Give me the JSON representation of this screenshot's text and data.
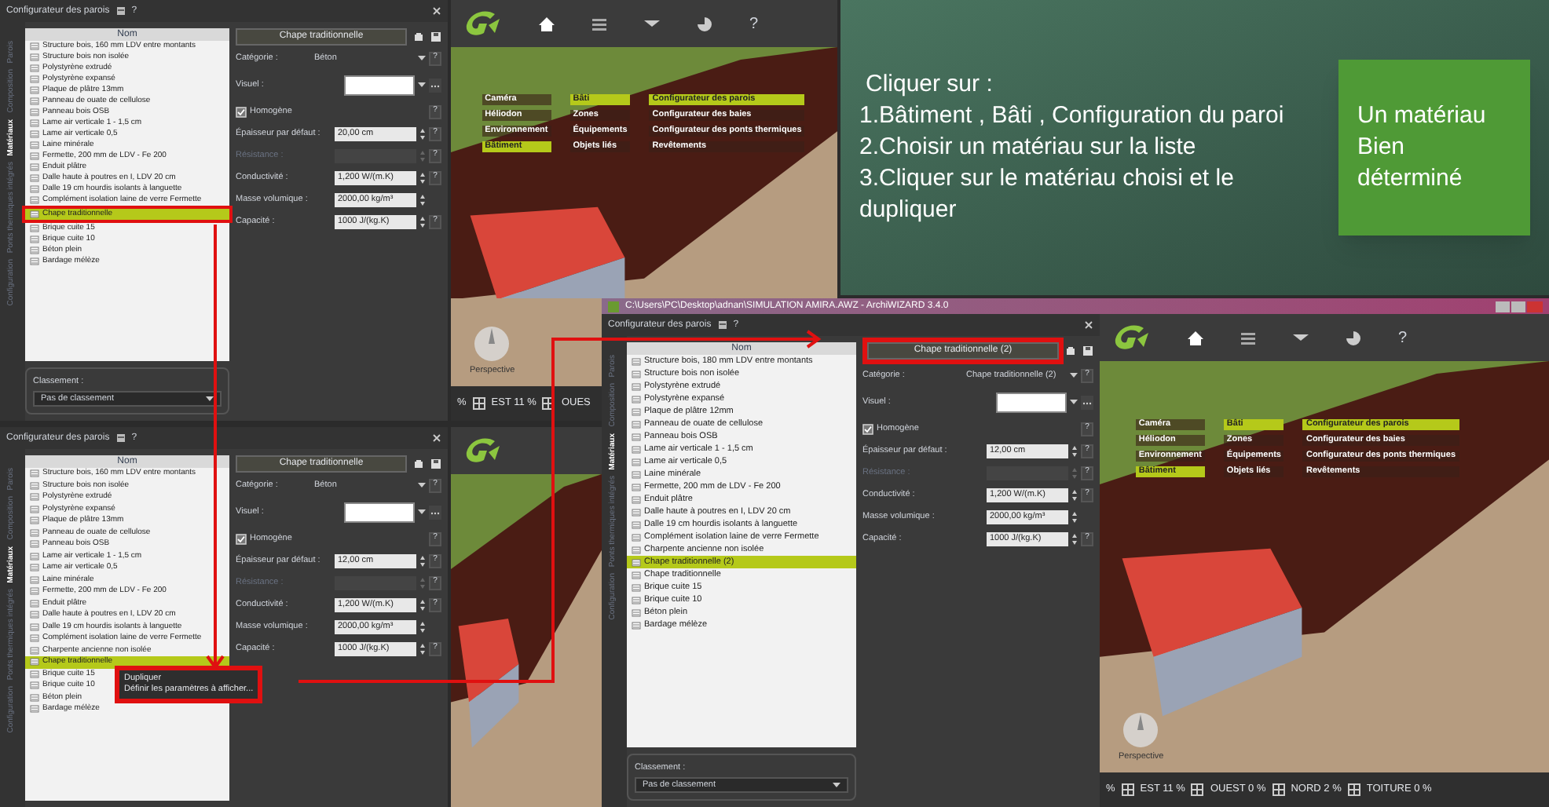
{
  "dialogs": [
    {
      "title": "Configurateur des parois",
      "help": "?",
      "row_framed": true,
      "tabs": [
        {
          "label": "Configuration",
          "selected": false
        },
        {
          "label": "Ponts thermiques intégrés",
          "selected": false
        },
        {
          "label": "Matériaux",
          "selected": true
        },
        {
          "label": "Composition",
          "selected": false
        },
        {
          "label": "Parois",
          "selected": false
        }
      ],
      "column": "Nom",
      "items": [
        {
          "label": "Structure bois, 160 mm LDV entre montants",
          "selected": false
        },
        {
          "label": "Structure bois non isolée",
          "selected": false
        },
        {
          "label": "Polystyrène extrudé",
          "selected": false
        },
        {
          "label": "Polystyrène expansé",
          "selected": false
        },
        {
          "label": "Plaque de plâtre 13mm",
          "selected": false
        },
        {
          "label": "Panneau de ouate de cellulose",
          "selected": false
        },
        {
          "label": "Panneau bois OSB",
          "selected": false
        },
        {
          "label": "Lame air verticale 1 - 1,5 cm",
          "selected": false
        },
        {
          "label": "Lame air verticale 0,5",
          "selected": false
        },
        {
          "label": "Laine minérale",
          "selected": false
        },
        {
          "label": "Fermette, 200 mm de LDV - Fe 200",
          "selected": false
        },
        {
          "label": "Enduit plâtre",
          "selected": false
        },
        {
          "label": "Dalle haute à poutres en I, LDV 20 cm",
          "selected": false
        },
        {
          "label": "Dalle 19 cm hourdis isolants à languette",
          "selected": false
        },
        {
          "label": "Complément isolation laine de verre Fermette",
          "selected": false
        },
        {
          "label": "Chape traditionnelle",
          "selected": true
        },
        {
          "label": "Brique cuite 15",
          "selected": false
        },
        {
          "label": "Brique cuite 10",
          "selected": false
        },
        {
          "label": "Béton plein",
          "selected": false
        },
        {
          "label": "Bardage mélèze",
          "selected": false
        }
      ],
      "header": "Chape traditionnelle",
      "fields": [
        {
          "kind": "select",
          "label": "Catégorie :",
          "value": "Béton",
          "help": "?"
        },
        {
          "kind": "color",
          "label": "Visuel :"
        },
        {
          "kind": "check",
          "label": "Homogène",
          "checked": true,
          "help": "?"
        },
        {
          "kind": "number",
          "label": "Épaisseur par défaut :",
          "value": "20,00 cm",
          "disabled": false,
          "help": "?"
        },
        {
          "kind": "number",
          "label": "Résistance :",
          "disabled": true,
          "help": "?"
        },
        {
          "kind": "number",
          "label": "Conductivité :",
          "value": "1,200 W/(m.K)",
          "disabled": false,
          "help": "?"
        },
        {
          "kind": "number",
          "label": "Masse volumique :",
          "value": "2000,00 kg/m³",
          "disabled": false
        },
        {
          "kind": "number",
          "label": "Capacité :",
          "value": "1000 J/(kg.K)",
          "disabled": false,
          "help": "?"
        }
      ],
      "classement_label": "Classement :",
      "classement_value": "Pas de classement"
    },
    {
      "title": "Configurateur des parois",
      "help": "?",
      "menu_framed": true,
      "tabs": [
        {
          "label": "Configuration",
          "selected": false
        },
        {
          "label": "Ponts thermiques intégrés",
          "selected": false
        },
        {
          "label": "Matériaux",
          "selected": true
        },
        {
          "label": "Composition",
          "selected": false
        },
        {
          "label": "Parois",
          "selected": false
        }
      ],
      "column": "Nom",
      "items": [
        {
          "label": "Structure bois, 160 mm LDV entre montants",
          "selected": false
        },
        {
          "label": "Structure bois non isolée",
          "selected": false
        },
        {
          "label": "Polystyrène extrudé",
          "selected": false
        },
        {
          "label": "Polystyrène expansé",
          "selected": false
        },
        {
          "label": "Plaque de plâtre 13mm",
          "selected": false
        },
        {
          "label": "Panneau de ouate de cellulose",
          "selected": false
        },
        {
          "label": "Panneau bois OSB",
          "selected": false
        },
        {
          "label": "Lame air verticale 1 - 1,5 cm",
          "selected": false
        },
        {
          "label": "Lame air verticale 0,5",
          "selected": false
        },
        {
          "label": "Laine minérale",
          "selected": false
        },
        {
          "label": "Fermette, 200 mm de LDV - Fe 200",
          "selected": false
        },
        {
          "label": "Enduit plâtre",
          "selected": false
        },
        {
          "label": "Dalle haute à poutres en I, LDV 20 cm",
          "selected": false
        },
        {
          "label": "Dalle 19 cm hourdis isolants à languette",
          "selected": false
        },
        {
          "label": "Complément isolation laine de verre Fermette",
          "selected": false
        },
        {
          "label": "Charpente ancienne non isolée",
          "selected": false
        },
        {
          "label": "Chape traditionnelle",
          "selected": true
        },
        {
          "label": "Brique cuite 15",
          "selected": false
        },
        {
          "label": "Brique cuite 10",
          "selected": false
        },
        {
          "label": "Béton plein",
          "selected": false
        },
        {
          "label": "Bardage mélèze",
          "selected": false
        }
      ],
      "header": "Chape traditionnelle",
      "fields": [
        {
          "kind": "select",
          "label": "Catégorie :",
          "value": "Béton",
          "help": "?"
        },
        {
          "kind": "color",
          "label": "Visuel :"
        },
        {
          "kind": "check",
          "label": "Homogène",
          "checked": true,
          "help": "?"
        },
        {
          "kind": "number",
          "label": "Épaisseur par défaut :",
          "value": "12,00 cm",
          "disabled": false,
          "help": "?"
        },
        {
          "kind": "number",
          "label": "Résistance :",
          "disabled": true,
          "help": "?"
        },
        {
          "kind": "number",
          "label": "Conductivité :",
          "value": "1,200 W/(m.K)",
          "disabled": false,
          "help": "?"
        },
        {
          "kind": "number",
          "label": "Masse volumique :",
          "value": "2000,00 kg/m³",
          "disabled": false
        },
        {
          "kind": "number",
          "label": "Capacité :",
          "value": "1000 J/(kg.K)",
          "disabled": false,
          "help": "?"
        }
      ],
      "context_menu": [
        "Dupliquer",
        "Définir les paramètres à afficher..."
      ]
    },
    {
      "title": "Configurateur des parois",
      "help": "?",
      "header_framed": true,
      "tabs": [
        {
          "label": "Configuration",
          "selected": false
        },
        {
          "label": "Ponts thermiques intégrés",
          "selected": false
        },
        {
          "label": "Matériaux",
          "selected": true
        },
        {
          "label": "Composition",
          "selected": false
        },
        {
          "label": "Parois",
          "selected": false
        }
      ],
      "column": "Nom",
      "items": [
        {
          "label": "Structure bois, 180 mm LDV entre montants",
          "selected": false
        },
        {
          "label": "Structure bois non isolée",
          "selected": false
        },
        {
          "label": "Polystyrène extrudé",
          "selected": false
        },
        {
          "label": "Polystyrène expansé",
          "selected": false
        },
        {
          "label": "Plaque de plâtre 12mm",
          "selected": false
        },
        {
          "label": "Panneau de ouate de cellulose",
          "selected": false
        },
        {
          "label": "Panneau bois OSB",
          "selected": false
        },
        {
          "label": "Lame air verticale 1 - 1,5 cm",
          "selected": false
        },
        {
          "label": "Lame air verticale 0,5",
          "selected": false
        },
        {
          "label": "Laine minérale",
          "selected": false
        },
        {
          "label": "Fermette, 200 mm de LDV - Fe 200",
          "selected": false
        },
        {
          "label": "Enduit plâtre",
          "selected": false
        },
        {
          "label": "Dalle haute à poutres en I, LDV 20 cm",
          "selected": false
        },
        {
          "label": "Dalle 19 cm hourdis isolants à languette",
          "selected": false
        },
        {
          "label": "Complément isolation laine de verre Fermette",
          "selected": false
        },
        {
          "label": "Charpente ancienne non isolée",
          "selected": false
        },
        {
          "label": "Chape traditionnelle (2)",
          "selected": true
        },
        {
          "label": "Chape traditionnelle",
          "selected": false
        },
        {
          "label": "Brique cuite 15",
          "selected": false
        },
        {
          "label": "Brique cuite 10",
          "selected": false
        },
        {
          "label": "Béton plein",
          "selected": false
        },
        {
          "label": "Bardage mélèze",
          "selected": false
        }
      ],
      "header": "Chape traditionnelle (2)",
      "fields": [
        {
          "kind": "select",
          "label": "Catégorie :",
          "value": "Chape traditionnelle (2)",
          "help": "?"
        },
        {
          "kind": "color",
          "label": "Visuel :"
        },
        {
          "kind": "check",
          "label": "Homogène",
          "checked": true,
          "help": "?"
        },
        {
          "kind": "number",
          "label": "Épaisseur par défaut :",
          "value": "12,00 cm",
          "disabled": false,
          "help": "?"
        },
        {
          "kind": "number",
          "label": "Résistance :",
          "disabled": true,
          "help": "?"
        },
        {
          "kind": "number",
          "label": "Conductivité :",
          "value": "1,200 W/(m.K)",
          "disabled": false,
          "help": "?"
        },
        {
          "kind": "number",
          "label": "Masse volumique :",
          "value": "2000,00 kg/m³",
          "disabled": false
        },
        {
          "kind": "number",
          "label": "Capacité :",
          "value": "1000 J/(kg.K)",
          "disabled": false,
          "help": "?"
        }
      ],
      "classement_label": "Classement :",
      "classement_value": "Pas de classement"
    }
  ],
  "views": [
    {
      "help": "?",
      "menu": [
        [
          {
            "label": "Caméra",
            "selected": false
          },
          {
            "label": "Héliodon",
            "selected": false
          },
          {
            "label": "Environnement",
            "selected": false
          },
          {
            "label": "Bâtiment",
            "selected": true
          }
        ],
        [
          {
            "label": "Bâti",
            "selected": true
          },
          {
            "label": "Zones",
            "selected": false
          },
          {
            "label": "Équipements",
            "selected": false
          },
          {
            "label": "Objets liés",
            "selected": false
          }
        ],
        [
          {
            "label": "Configurateur des parois",
            "selected": true
          },
          {
            "label": "Configurateur des baies",
            "selected": false
          },
          {
            "label": "Configurateur des ponts thermiques",
            "selected": false
          },
          {
            "label": "Revêtements",
            "selected": false
          }
        ]
      ],
      "compass_label": "Perspective",
      "status": [
        "%",
        "EST 11 %",
        "OUES"
      ]
    },
    {
      "help": "?",
      "menu": [
        [
          {
            "label": "Caméra",
            "selected": false
          },
          {
            "label": "Héliodon",
            "selected": false
          },
          {
            "label": "Environnement",
            "selected": false
          },
          {
            "label": "Bâtiment",
            "selected": true
          }
        ],
        [
          {
            "label": "Bâti",
            "selected": true
          },
          {
            "label": "Zones",
            "selected": false
          },
          {
            "label": "Équipements",
            "selected": false
          },
          {
            "label": "Objets liés",
            "selected": false
          }
        ],
        [
          {
            "label": "Configurateur des parois",
            "selected": true
          },
          {
            "label": "Configurateur des baies",
            "selected": false
          },
          {
            "label": "Configurateur des ponts thermiques",
            "selected": false
          },
          {
            "label": "Revêtements",
            "selected": false
          }
        ]
      ],
      "compass_label": "Perspective",
      "status": [
        "%",
        "EST 11 %",
        "OUEST 0 %",
        "NORD 2 %",
        "TOITURE 0 %"
      ]
    }
  ],
  "app_window": {
    "title": "C:\\Users\\PC\\Desktop\\adnan\\SIMULATION AMIRA.AWZ  -  ArchiWIZARD 3.4.0"
  },
  "instructions": {
    "heading": "Cliquer sur :",
    "steps": [
      "1.Bâtiment , Bâti ,  Configuration du paroi",
      "2.Choisir un matériau sur la liste",
      "3.Cliquer sur le matériau choisi et le dupliquer"
    ],
    "note": [
      "Un matériau",
      "Bien",
      "déterminé"
    ]
  }
}
